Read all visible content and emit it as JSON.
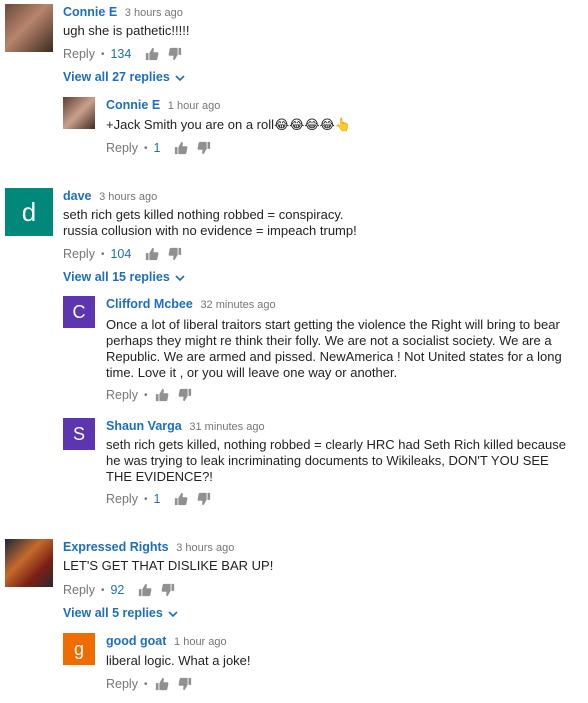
{
  "comments": [
    {
      "author": "Connie E",
      "time": "3 hours ago",
      "text": "ugh she is pathetic!!!!!",
      "reply_label": "Reply",
      "likes": "134",
      "view_replies": "View all 27 replies",
      "replies": [
        {
          "author": "Connie E",
          "time": "1 hour ago",
          "text": "+Jack Smith you are on a roll😂😂😂😂👆",
          "reply_label": "Reply",
          "likes": "1"
        }
      ]
    },
    {
      "author": "dave",
      "time": "3 hours ago",
      "avatar_letter": "d",
      "avatar_color": "#00897b",
      "text_lines": [
        "seth rich gets killed nothing robbed = conspiracy.",
        "russia collusion with no evidence = impeach trump!"
      ],
      "reply_label": "Reply",
      "likes": "104",
      "view_replies": "View all 15 replies",
      "replies": [
        {
          "author": "Clifford Mcbee",
          "time": "32 minutes ago",
          "avatar_letter": "C",
          "avatar_color": "#5e35b1",
          "text": "Once a lot of liberal traitors start getting the violence the Right will bring to bear perhaps they might re think their folly. We are not a socialist society. We are a Republic. We are armed and pissed. NewAmerica ! Not United states for a long time. Love it , or you will leave one way or another.",
          "reply_label": "Reply"
        },
        {
          "author": "Shaun Varga",
          "time": "31 minutes ago",
          "avatar_letter": "S",
          "avatar_color": "#5e35b1",
          "text": "seth rich gets killed, nothing robbed = clearly HRC had Seth Rich killed because he was trying to leak incriminating documents to Wikileaks, DON'T YOU SEE THE EVIDENCE?!",
          "reply_label": "Reply",
          "likes": "1"
        }
      ]
    },
    {
      "author": "Expressed Rights",
      "time": "3 hours ago",
      "text": "LET'S GET THAT DISLIKE BAR UP!",
      "reply_label": "Reply",
      "likes": "92",
      "view_replies": "View all 5 replies",
      "replies": [
        {
          "author": "good goat",
          "time": "1 hour ago",
          "avatar_letter": "g",
          "avatar_color": "#ef6c00",
          "text": "liberal logic. What a joke!",
          "reply_label": "Reply"
        }
      ]
    }
  ]
}
